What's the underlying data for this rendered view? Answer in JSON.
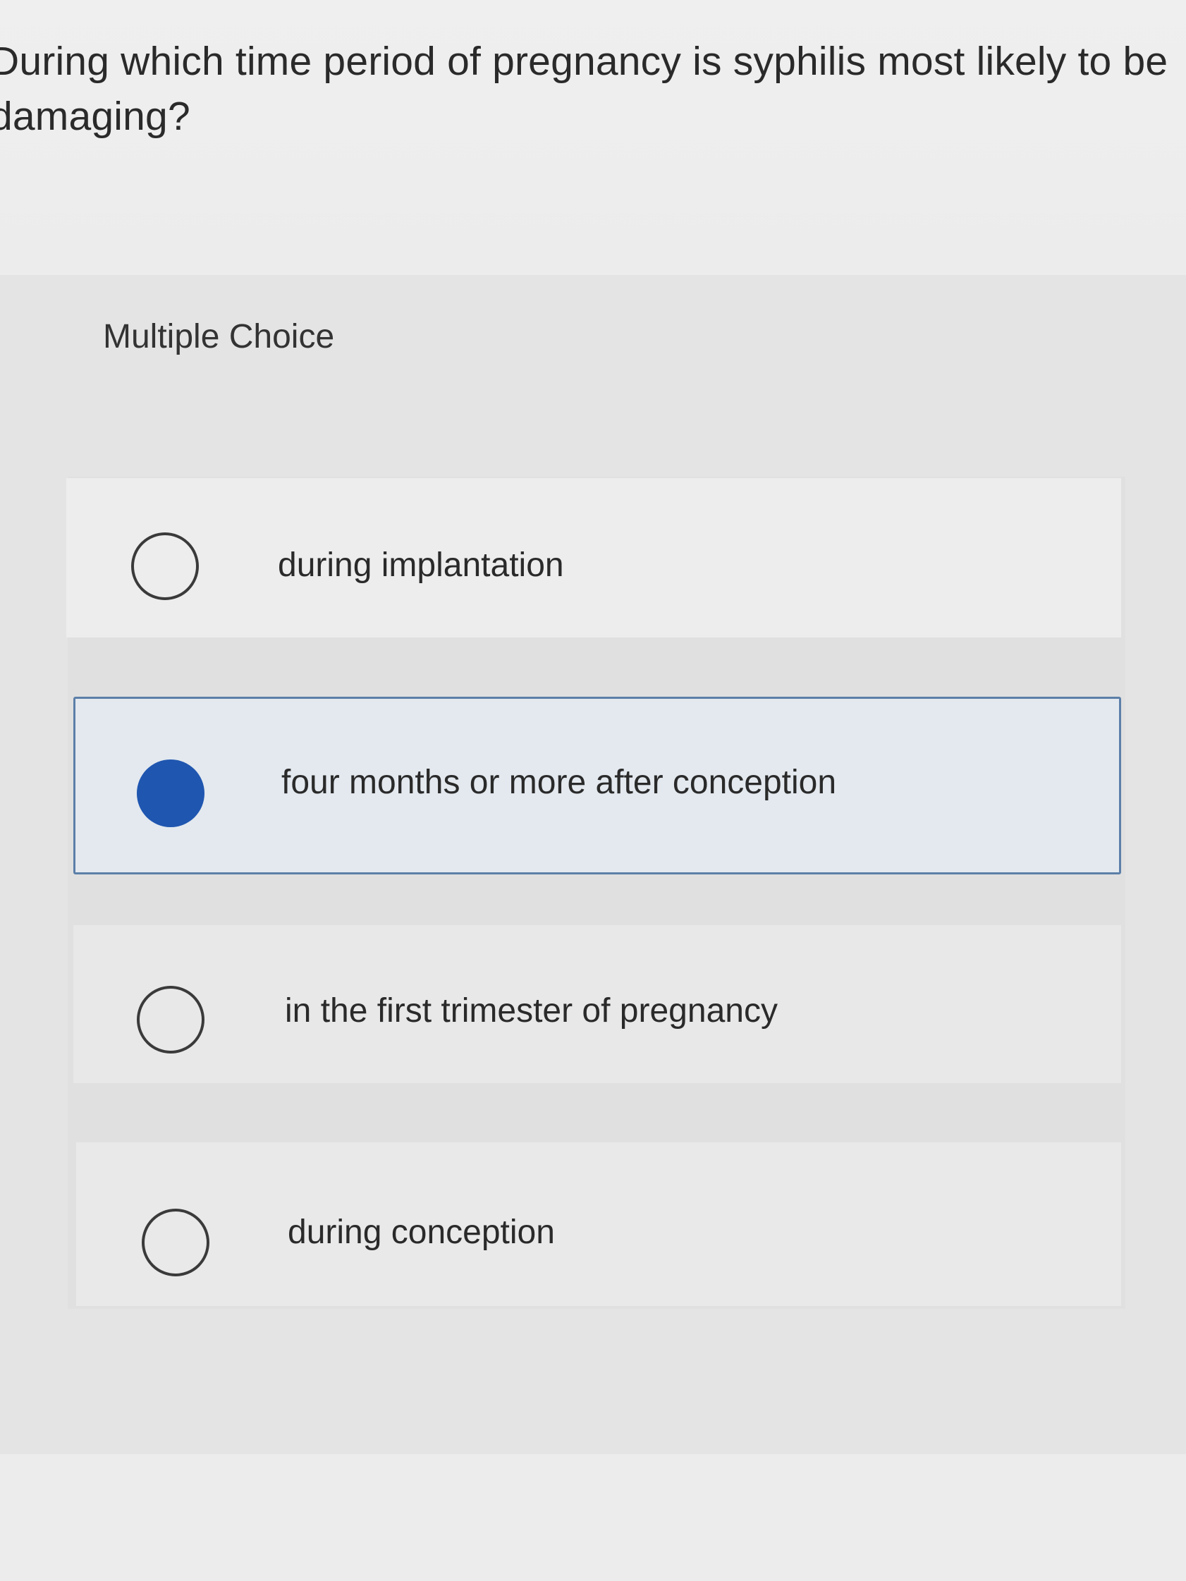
{
  "question": {
    "text": "During which time period of pregnancy is syphilis most likely to be damaging?"
  },
  "section": {
    "label": "Multiple Choice"
  },
  "choices": [
    {
      "label": "during implantation",
      "selected": false
    },
    {
      "label": "four months or more after conception",
      "selected": true
    },
    {
      "label": "in the first trimester of pregnancy",
      "selected": false
    },
    {
      "label": "during conception",
      "selected": false
    }
  ],
  "colors": {
    "selected_radio": "#1f56b0",
    "selected_border": "#5c7fa8",
    "selected_background": "#e3e9ef"
  }
}
